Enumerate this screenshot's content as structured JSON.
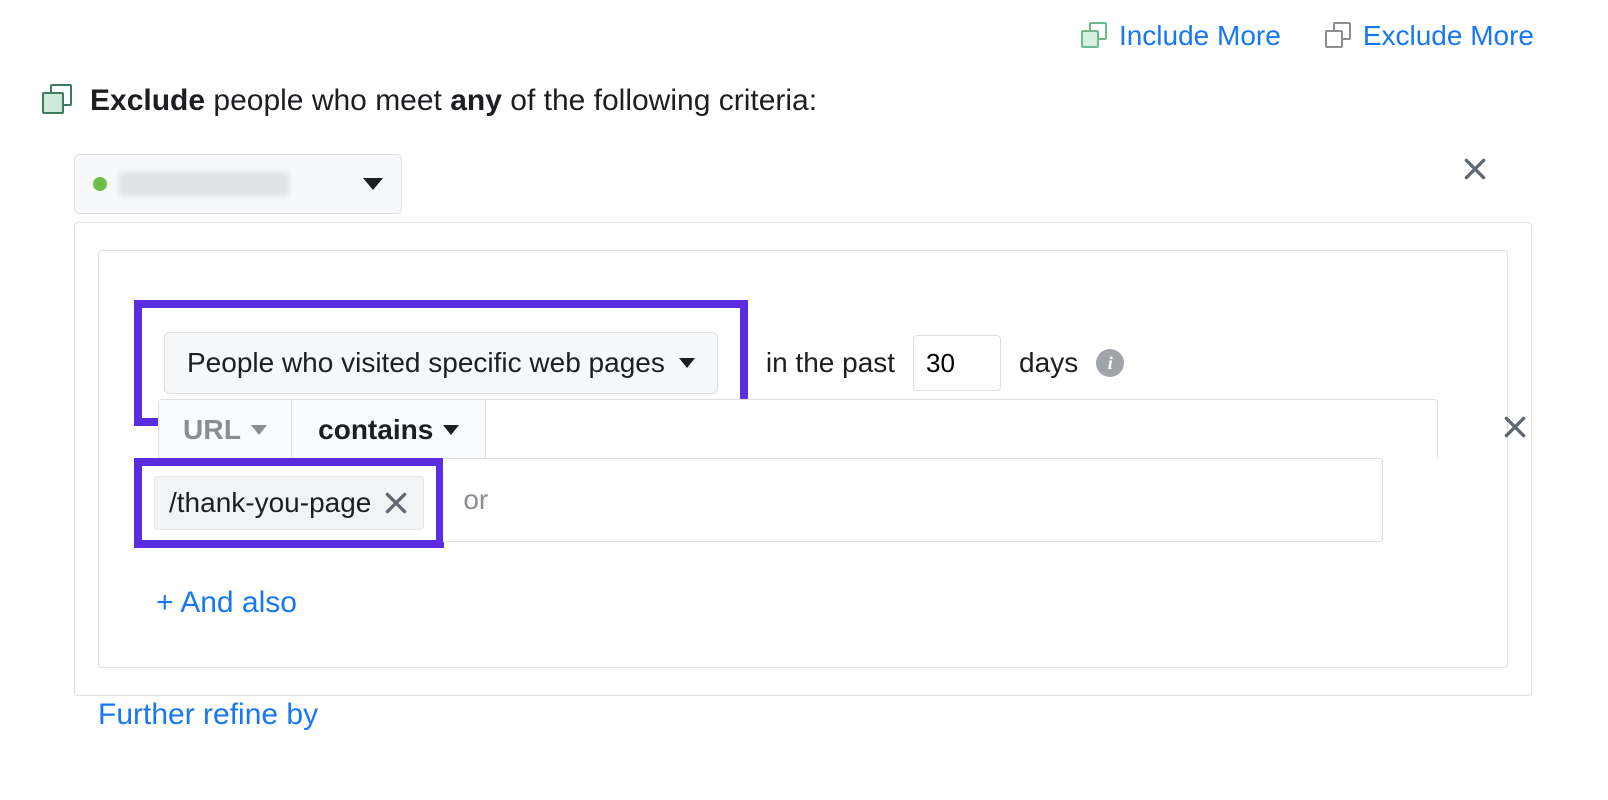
{
  "top_links": {
    "include_more": "Include More",
    "exclude_more": "Exclude More"
  },
  "section": {
    "lead_bold": "Exclude",
    "mid": " people who meet ",
    "any_bold": "any",
    "tail": " of the following criteria:"
  },
  "source": {
    "status": "active"
  },
  "rule": {
    "visited_label": "People who visited specific web pages",
    "in_the_past": "in the past",
    "days_value": "30",
    "days_label": "days",
    "url_field_label": "URL",
    "match_label": "contains",
    "chips": [
      "/thank-you-page"
    ],
    "input_placeholder": "or",
    "and_also": "+ And also"
  },
  "further_refine": "Further refine by"
}
